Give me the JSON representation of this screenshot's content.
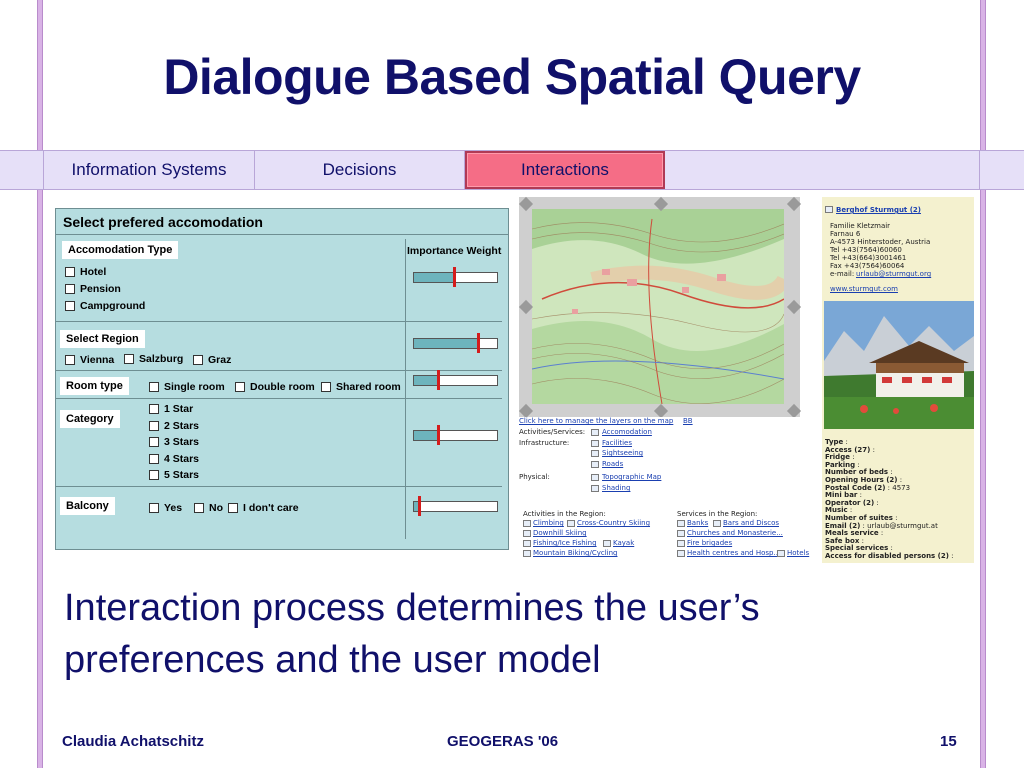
{
  "slide": {
    "title": "Dialogue Based Spatial Query",
    "subtitle": "Interaction process determines the user’s preferences and the user model",
    "footer": {
      "author": "Claudia Achatschitz",
      "event": "GEOGERAS '06",
      "page": "15"
    }
  },
  "tabs": [
    {
      "label": "Information Systems",
      "active": false
    },
    {
      "label": "Decisions",
      "active": false
    },
    {
      "label": "Interactions",
      "active": true
    },
    {
      "label": "",
      "active": false
    }
  ],
  "dialog": {
    "title": "Select prefered accomodation",
    "importance_header": "Importance Weight",
    "sections": {
      "accommodation": {
        "label": "Accomodation Type",
        "options": [
          "Hotel",
          "Pension",
          "Campground"
        ],
        "weight": 0.48
      },
      "region": {
        "label": "Select Region",
        "options": [
          "Vienna",
          "Salzburg",
          "Graz"
        ],
        "weight": 0.77
      },
      "room": {
        "label": "Room type",
        "options": [
          "Single room",
          "Double room",
          "Shared room"
        ],
        "weight": 0.29
      },
      "category": {
        "label": "Category",
        "options": [
          "1 Star",
          "2 Stars",
          "3 Stars",
          "4 Stars",
          "5 Stars"
        ],
        "weight": 0.29
      },
      "balcony": {
        "label": "Balcony",
        "options": [
          "Yes",
          "No",
          "I don't care"
        ],
        "weight": 0.06
      }
    }
  },
  "map_panel": {
    "manage_link": "Click here to manage the layers on the map",
    "manage_link2": "BB",
    "layers": [
      {
        "group": "Activities/Services:",
        "items": [
          "Accomodation"
        ]
      },
      {
        "group": "Infrastructure:",
        "items": [
          "Facilities",
          "Sightseeing",
          "Roads"
        ]
      },
      {
        "group": "Physical:",
        "items": [
          "Topographic Map",
          "Shading"
        ]
      }
    ],
    "activities_header": "Activities in the Region:",
    "activities": [
      "Climbing",
      "Cross-Country Skiing",
      "Downhill Skiing",
      "Fishing/Ice Fishing",
      "Kayak",
      "Mountain Biking/Cycling"
    ],
    "services_header": "Services in the Region:",
    "services": [
      "Banks",
      "Bars and Discos",
      "Churches and Monasterie...",
      "Fire brigades",
      "Health centres and Hosp...",
      "Hotels"
    ]
  },
  "hotel": {
    "name": "Berghof Sturmgut (2)",
    "address": [
      "Familie Kletzmair",
      "Farnau 6",
      "A-4573 Hinterstoder, Austria",
      "Tel +43(7564)60060",
      "Tel +43(664)3001461",
      "Fax +43(7564)60064"
    ],
    "email_label": "e-mail:",
    "email": "urlaub@sturmgut.org",
    "website": "www.sturmgut.com",
    "attributes": [
      {
        "k": "Type",
        "v": ""
      },
      {
        "k": "Access (27)",
        "v": ""
      },
      {
        "k": "Fridge",
        "v": ""
      },
      {
        "k": "Parking",
        "v": ""
      },
      {
        "k": "Number of beds",
        "v": ""
      },
      {
        "k": "Opening Hours (2)",
        "v": ""
      },
      {
        "k": "Postal Code (2)",
        "v": "4573"
      },
      {
        "k": "Mini bar",
        "v": ""
      },
      {
        "k": "Operator (2)",
        "v": ""
      },
      {
        "k": "Music",
        "v": ""
      },
      {
        "k": "Number of suites",
        "v": ""
      },
      {
        "k": "Email (2)",
        "v": "urlaub@sturmgut.at"
      },
      {
        "k": "Meals service",
        "v": ""
      },
      {
        "k": "Safe box",
        "v": ""
      },
      {
        "k": "Special services",
        "v": ""
      },
      {
        "k": "Access for disabled persons (2)",
        "v": ""
      }
    ]
  },
  "colors": {
    "title": "#10106a",
    "active_tab": "#f56d86",
    "dialog_bg": "#b6dde0",
    "slider_fill": "#6db4bd",
    "slider_knob": "#d41c1c",
    "frame": "#d9b3e6"
  }
}
